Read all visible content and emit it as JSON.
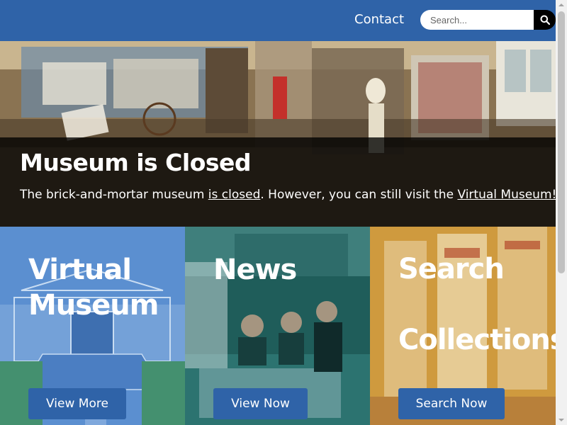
{
  "nav": {
    "contact_label": "Contact",
    "search_placeholder": "Search...",
    "search_icon": "search-icon"
  },
  "hero": {
    "title": "Museum is Closed",
    "text_before": "The brick-and-mortar museum ",
    "closed_link": "is closed",
    "text_middle": ".  However, you can still visit the ",
    "virtual_link": "Virtual Museum!"
  },
  "cards": [
    {
      "title_line1": "Virtual",
      "title_line2": "Museum",
      "button": "View More"
    },
    {
      "title_line1": "News",
      "button": "View Now"
    },
    {
      "title_line1": "Search",
      "title_line2": "Collections",
      "button": "Search Now"
    }
  ],
  "colors": {
    "nav_bg": "#2f63a8",
    "button_bg": "#2f63a8",
    "card1_tint": "#5b8fd0",
    "card2_tint": "#1f5d5a",
    "card3_tint": "#cf9a3e"
  }
}
